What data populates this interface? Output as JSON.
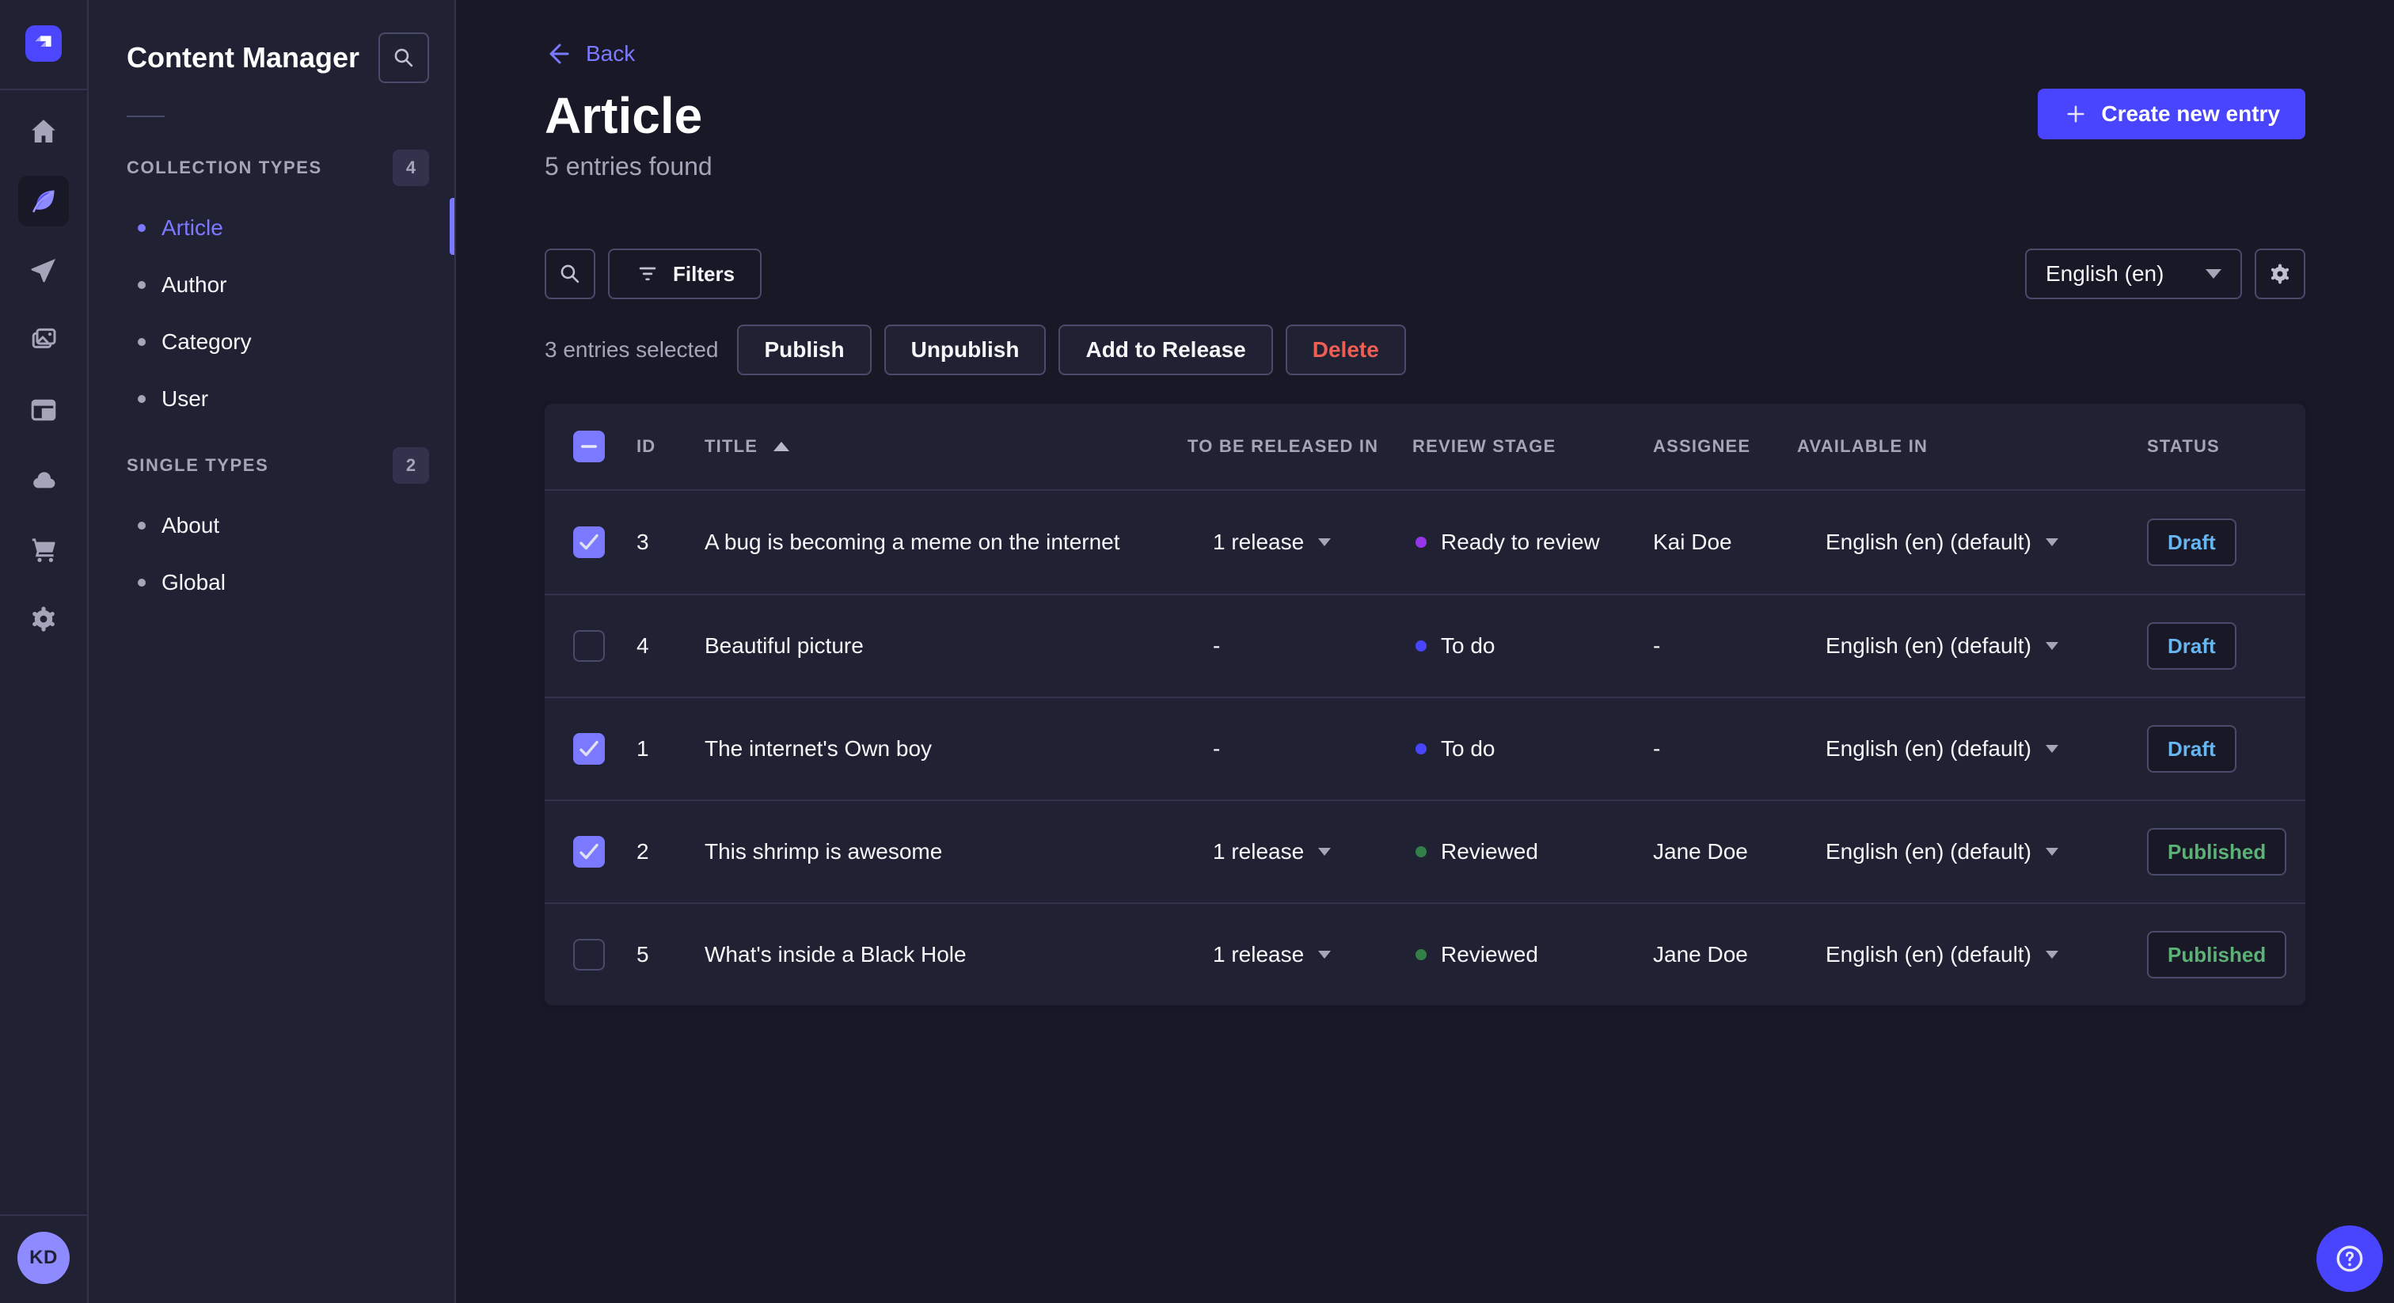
{
  "colors": {
    "accent": "#4945ff",
    "accent_light": "#7b79ff",
    "bg_main": "#181826",
    "bg_panel": "#212134",
    "border_subtle": "#32324d",
    "border_control": "#4a4a6a",
    "text_secondary": "#a5a5ba",
    "status_draft": "#66b7f1",
    "status_published": "#5cb176",
    "danger": "#ee5e52"
  },
  "rail": {
    "logo": "strapi-logo",
    "items": [
      {
        "icon": "home-icon",
        "active": false
      },
      {
        "icon": "content-manager-icon",
        "active": true
      },
      {
        "icon": "releases-icon",
        "active": false
      },
      {
        "icon": "media-library-icon",
        "active": false
      },
      {
        "icon": "content-type-builder-icon",
        "active": false
      },
      {
        "icon": "cloud-icon",
        "active": false
      },
      {
        "icon": "marketplace-icon",
        "active": false
      },
      {
        "icon": "settings-icon",
        "active": false
      }
    ],
    "avatar_initials": "KD"
  },
  "panel": {
    "title": "Content Manager",
    "sections": [
      {
        "label": "COLLECTION TYPES",
        "badge": "4",
        "items": [
          {
            "label": "Article",
            "active": true
          },
          {
            "label": "Author",
            "active": false
          },
          {
            "label": "Category",
            "active": false
          },
          {
            "label": "User",
            "active": false
          }
        ]
      },
      {
        "label": "SINGLE TYPES",
        "badge": "2",
        "items": [
          {
            "label": "About",
            "active": false
          },
          {
            "label": "Global",
            "active": false
          }
        ]
      }
    ]
  },
  "header": {
    "back": "Back",
    "title": "Article",
    "subtitle": "5 entries found",
    "create": "Create new entry"
  },
  "toolbar": {
    "filters": "Filters",
    "locale": "English (en)"
  },
  "selection": {
    "label": "3 entries selected",
    "actions": [
      {
        "label": "Publish",
        "variant": "default"
      },
      {
        "label": "Unpublish",
        "variant": "default"
      },
      {
        "label": "Add to Release",
        "variant": "default"
      },
      {
        "label": "Delete",
        "variant": "danger"
      }
    ]
  },
  "table": {
    "columns": [
      "ID",
      "TITLE",
      "TO BE RELEASED IN",
      "REVIEW STAGE",
      "ASSIGNEE",
      "AVAILABLE IN",
      "STATUS"
    ],
    "sort_column": "TITLE",
    "sort_direction": "asc",
    "rows": [
      {
        "checked": true,
        "id": "3",
        "title": "A bug is becoming a meme on the internet",
        "release": "1 release",
        "stage": "Ready to review",
        "stage_color": "#9736e8",
        "assignee": "Kai Doe",
        "locale": "English (en) (default)",
        "status": "Draft"
      },
      {
        "checked": false,
        "id": "4",
        "title": "Beautiful picture",
        "release": "-",
        "stage": "To do",
        "stage_color": "#4945ff",
        "assignee": "-",
        "locale": "English (en) (default)",
        "status": "Draft"
      },
      {
        "checked": true,
        "id": "1",
        "title": "The internet's Own boy",
        "release": "-",
        "stage": "To do",
        "stage_color": "#4945ff",
        "assignee": "-",
        "locale": "English (en) (default)",
        "status": "Draft"
      },
      {
        "checked": true,
        "id": "2",
        "title": "This shrimp is awesome",
        "release": "1 release",
        "stage": "Reviewed",
        "stage_color": "#328048",
        "assignee": "Jane Doe",
        "locale": "English (en) (default)",
        "status": "Published"
      },
      {
        "checked": false,
        "id": "5",
        "title": "What's inside a Black Hole",
        "release": "1 release",
        "stage": "Reviewed",
        "stage_color": "#328048",
        "assignee": "Jane Doe",
        "locale": "English (en) (default)",
        "status": "Published"
      }
    ]
  }
}
